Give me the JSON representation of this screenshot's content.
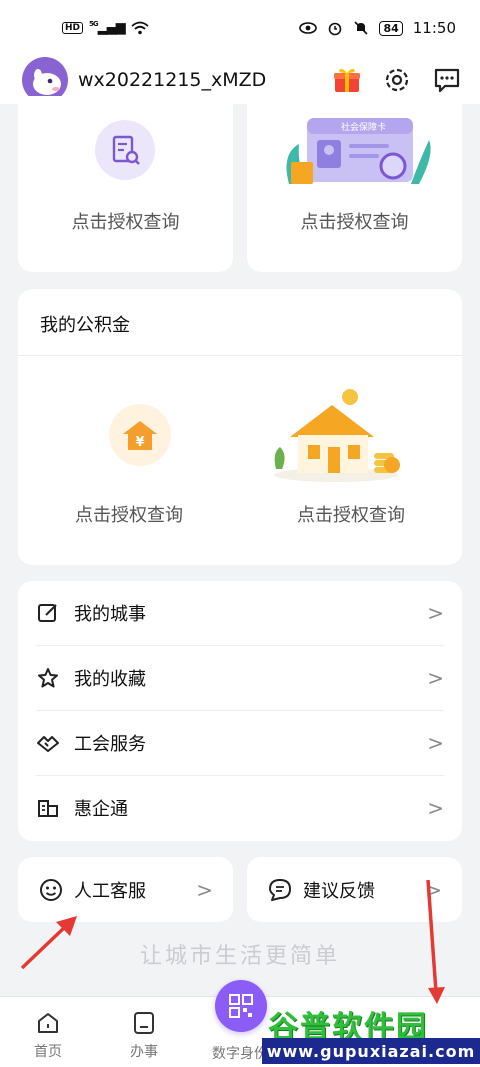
{
  "status_bar": {
    "hd": "HD",
    "signal": "5G",
    "battery": "84",
    "time": "11:50"
  },
  "header": {
    "username": "wx20221215_xMZD"
  },
  "top_cards": {
    "left_label": "点击授权查询",
    "right_label": "点击授权查询",
    "right_card_image_text": "社会保障卡"
  },
  "fund_section": {
    "title": "我的公积金",
    "left_label": "点击授权查询",
    "right_label": "点击授权查询",
    "coin_symbol": "¥"
  },
  "menu": {
    "items": [
      {
        "label": "我的城事",
        "icon": "edit-icon"
      },
      {
        "label": "我的收藏",
        "icon": "star-icon"
      },
      {
        "label": "工会服务",
        "icon": "union-icon"
      },
      {
        "label": "惠企通",
        "icon": "building-icon"
      }
    ],
    "chevron": ">"
  },
  "bottom_cards": {
    "customer_service": "人工客服",
    "feedback": "建议反馈",
    "chevron": ">"
  },
  "slogan": "让城市生活更简单",
  "tabbar": {
    "tabs": [
      {
        "label": "首页",
        "icon": "home-icon"
      },
      {
        "label": "办事",
        "icon": "task-icon"
      },
      {
        "label": "数字身份",
        "icon": "qr-code-icon"
      }
    ]
  },
  "watermark": {
    "brand": "谷普软件园",
    "url": "www.gupuxiazai.com"
  },
  "colors": {
    "accent": "#8b5cf6",
    "orange": "#f5a623",
    "annotation_arrow": "#e53935"
  }
}
